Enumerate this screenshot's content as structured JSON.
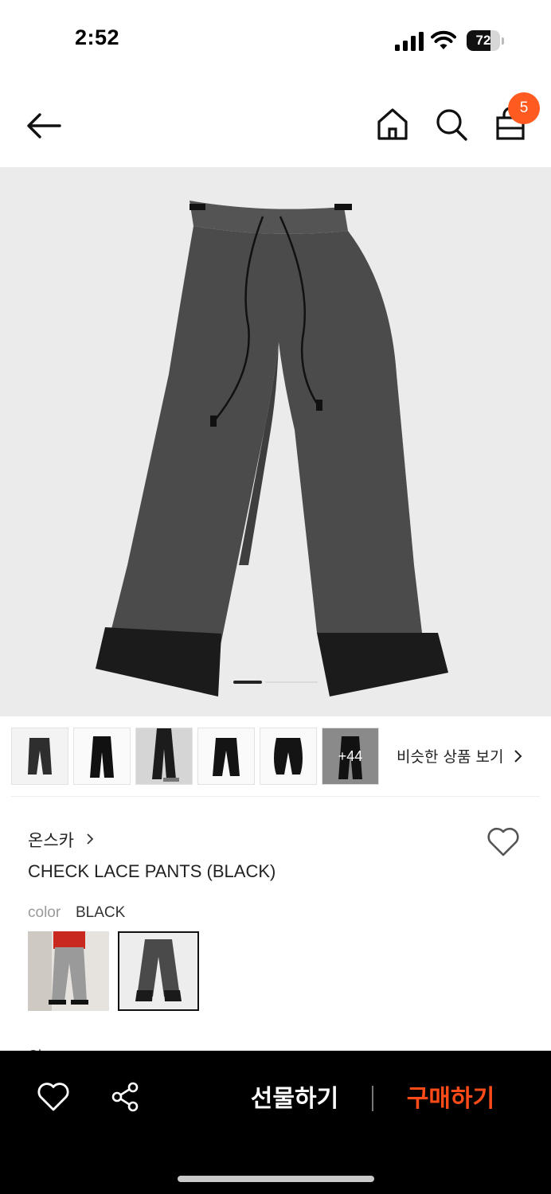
{
  "status_bar": {
    "time": "2:52",
    "battery_level": "72",
    "battery_fraction": 0.72
  },
  "nav": {
    "back_icon": "arrow-left-icon",
    "home_icon": "home-icon",
    "search_icon": "search-icon",
    "cart_icon": "shopping-bag-icon",
    "cart_count": "5",
    "badge_color": "#ff5a1f"
  },
  "gallery": {
    "current_index": 1,
    "more_count_label": "+44",
    "similar_label": "비슷한 상품 보기"
  },
  "product": {
    "brand": "온스카",
    "name": "CHECK LACE PANTS (BLACK)",
    "color_label": "color",
    "color_value": "BLACK",
    "partial_price_text": "원"
  },
  "actions": {
    "gift_label": "선물하기",
    "buy_label": "구매하기",
    "buy_color": "#ff4b17"
  }
}
